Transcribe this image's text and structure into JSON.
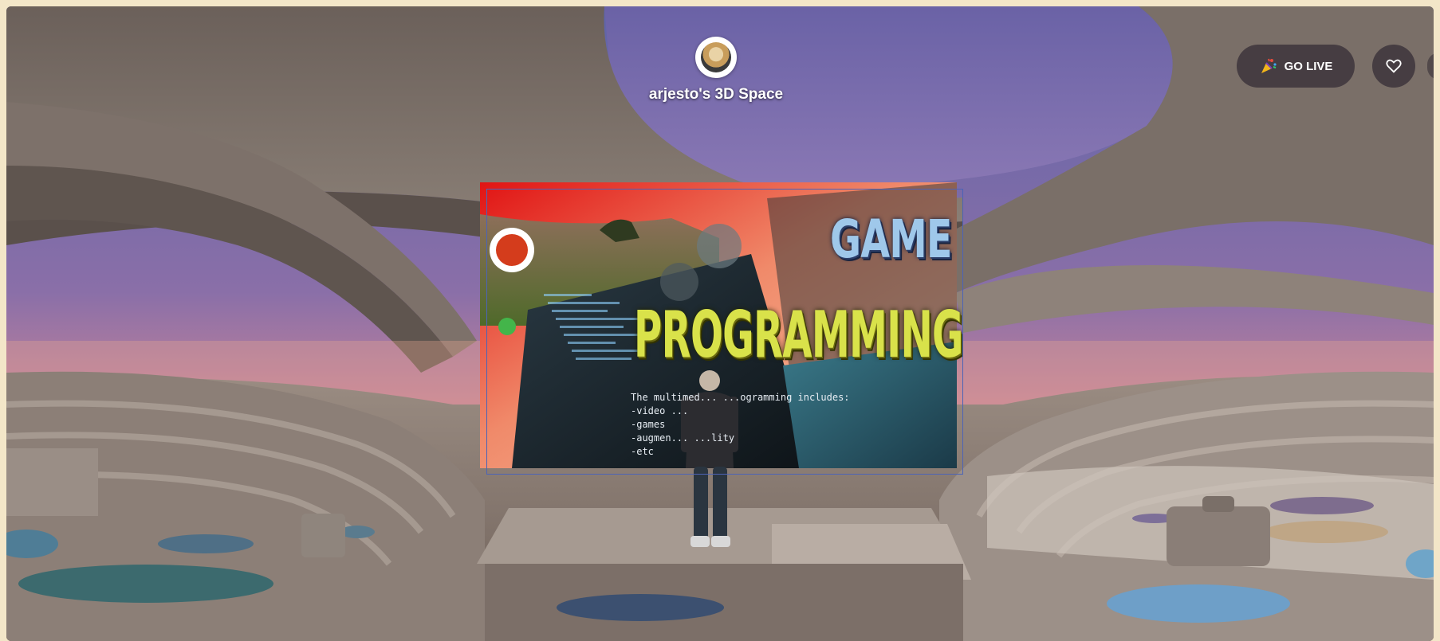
{
  "space": {
    "title": "arjesto's 3D Space"
  },
  "toolbar": {
    "go_live_label": "GO LIVE"
  },
  "screen": {
    "headline_top": "GAME",
    "headline_bottom": "PROGRAMMING",
    "body_lines": [
      "The multimed... ...ogramming includes:",
      "-video ...",
      "-games",
      "-augmen... ...lity",
      "-etc"
    ]
  },
  "colors": {
    "page_background": "#f3e6c8",
    "button_background": "#373037",
    "accent_green": "#43b54a",
    "headline_top": "#9fc8ea",
    "headline_bottom": "#d9e24a"
  },
  "icons": {
    "go_live": "party-popper-icon",
    "like": "heart-icon",
    "avatar": "user-avatar",
    "nav": "arrow-left-icon"
  }
}
